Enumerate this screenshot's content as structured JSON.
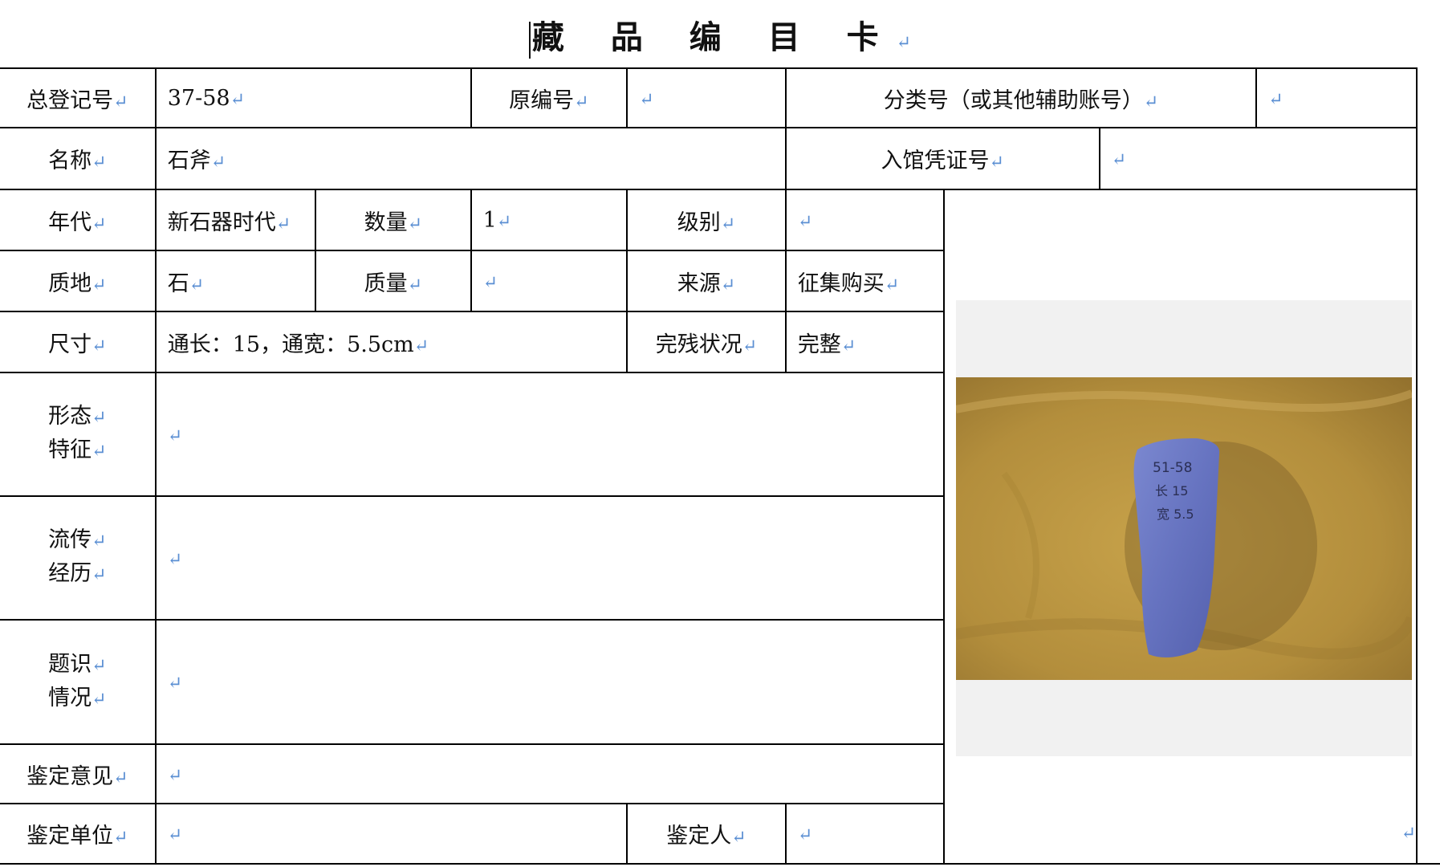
{
  "title": "藏 品 编 目 卡",
  "mark": "↵",
  "row1": {
    "reg_no_label": "总登记号",
    "reg_no_value": "37-58",
    "orig_no_label": "原编号",
    "class_no_label": "分类号（或其他辅助账号）"
  },
  "row2": {
    "name_label": "名称",
    "name_value": "石斧",
    "voucher_label": "入馆凭证号"
  },
  "row3": {
    "era_label": "年代",
    "era_value": "新石器时代",
    "qty_label": "数量",
    "qty_value": "1",
    "grade_label": "级别"
  },
  "row4": {
    "material_label": "质地",
    "material_value": "石",
    "mass_label": "质量",
    "source_label": "来源",
    "source_value": "征集购买"
  },
  "row5": {
    "size_label": "尺寸",
    "size_value": "通长：15，通宽：5.5cm",
    "condition_label": "完残状况",
    "condition_value": "完整"
  },
  "row6": {
    "label_a": "形态",
    "label_b": "特征"
  },
  "row7": {
    "label_a": "流传",
    "label_b": "经历"
  },
  "row8": {
    "label_a": "题识",
    "label_b": "情况"
  },
  "row9": {
    "label": "鉴定意见"
  },
  "row10": {
    "unit_label": "鉴定单位",
    "person_label": "鉴定人"
  },
  "photo": {
    "stone_text_line1": "51-58",
    "stone_text_line2": "长 15",
    "stone_text_line3": "宽 5.5",
    "background_color": "#b8953f",
    "stone_color": "#6e7cc4"
  }
}
